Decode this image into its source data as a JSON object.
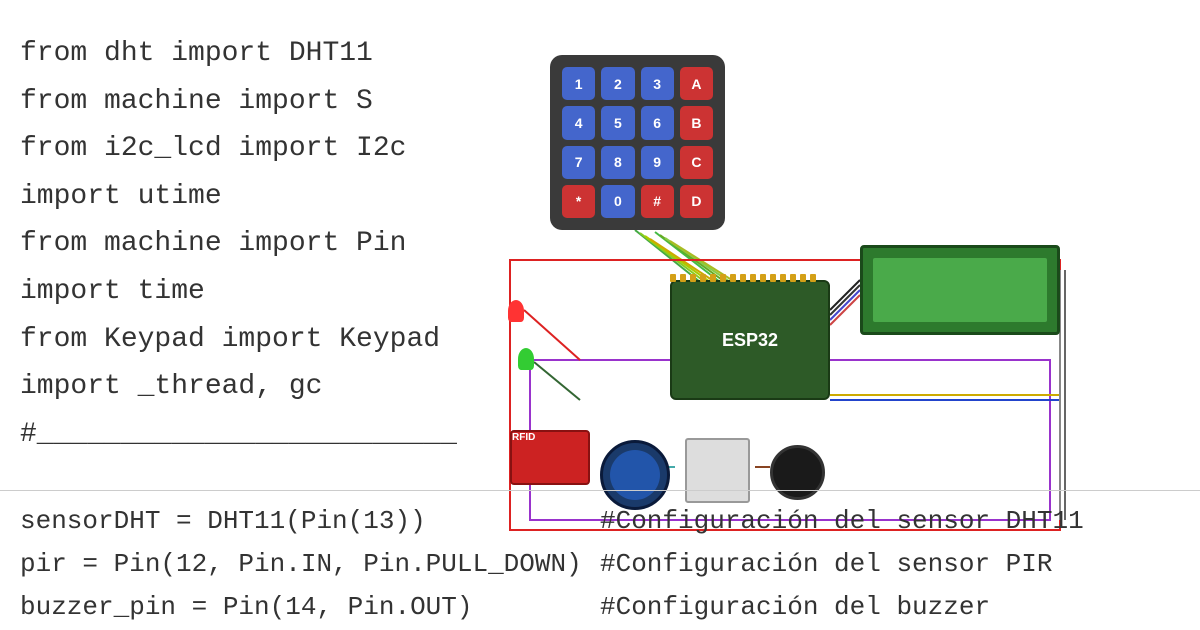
{
  "code": {
    "lines": [
      "from dht import DHT11",
      "from machine import S",
      "from i2c_lcd import I2c",
      "import utime",
      "from machine import Pin",
      "import time",
      "from Keypad import Keypad",
      "import _thread, gc",
      "#_________________________"
    ],
    "bottom_left": [
      "sensorDHT = DHT11(Pin(13))",
      "pir = Pin(12, Pin.IN, Pin.PULL_DOWN)",
      "buzzer_pin = Pin(14, Pin.OUT)"
    ],
    "bottom_right": [
      "#Configuración del sensor DHT11",
      "#Configuración del sensor PIR",
      "#Configuración del buzzer"
    ]
  },
  "keypad": {
    "keys": [
      {
        "label": "1",
        "type": "blue"
      },
      {
        "label": "2",
        "type": "blue"
      },
      {
        "label": "3",
        "type": "blue"
      },
      {
        "label": "A",
        "type": "red"
      },
      {
        "label": "4",
        "type": "blue"
      },
      {
        "label": "5",
        "type": "blue"
      },
      {
        "label": "6",
        "type": "blue"
      },
      {
        "label": "B",
        "type": "red"
      },
      {
        "label": "7",
        "type": "blue"
      },
      {
        "label": "8",
        "type": "blue"
      },
      {
        "label": "9",
        "type": "blue"
      },
      {
        "label": "C",
        "type": "red"
      },
      {
        "label": "*",
        "type": "red"
      },
      {
        "label": "0",
        "type": "blue"
      },
      {
        "label": "#",
        "type": "red"
      },
      {
        "label": "D",
        "type": "red"
      }
    ]
  },
  "esp32": {
    "label": "ESP32"
  },
  "colors": {
    "background": "#ffffff",
    "text": "#333333",
    "keyBlue": "#4466cc",
    "keyRed": "#cc3333",
    "esp32Body": "#2d5a27",
    "lcdGreen": "#2d7a2d",
    "ledRed": "#ff3333",
    "ledGreen": "#33cc33",
    "rfid": "#cc2222",
    "buzzer": "#1a1a1a",
    "pir": "#1a3a6a"
  }
}
